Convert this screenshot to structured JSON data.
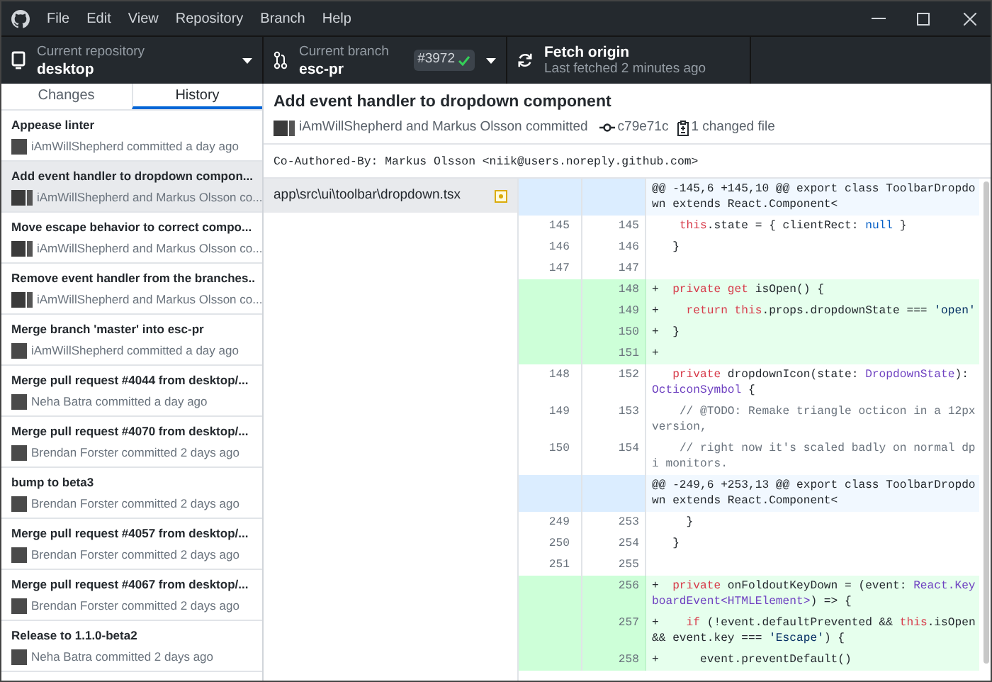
{
  "menu": [
    "File",
    "Edit",
    "View",
    "Repository",
    "Branch",
    "Help"
  ],
  "toolbar": {
    "repository": {
      "label": "Current repository",
      "value": "desktop"
    },
    "branch": {
      "label": "Current branch",
      "value": "esc-pr",
      "pr_badge": "#3972"
    },
    "fetch": {
      "title": "Fetch origin",
      "subtitle": "Last fetched 2 minutes ago"
    }
  },
  "tabs": [
    {
      "label": "Changes",
      "selected": false
    },
    {
      "label": "History",
      "selected": true
    }
  ],
  "commits": [
    {
      "title": "Appease linter",
      "author": "iAmWillShepherd committed a day ago",
      "coauthored": false,
      "selected": false
    },
    {
      "title": "Add event handler to dropdown compon...",
      "author": "iAmWillShepherd and Markus Olsson co...",
      "coauthored": true,
      "selected": true
    },
    {
      "title": "Move escape behavior to correct compo...",
      "author": "iAmWillShepherd and Markus Olsson co...",
      "coauthored": true,
      "selected": false
    },
    {
      "title": "Remove event handler from the branches..",
      "author": "iAmWillShepherd and Markus Olsson co...",
      "coauthored": true,
      "selected": false
    },
    {
      "title": "Merge branch 'master' into esc-pr",
      "author": "iAmWillShepherd committed a day ago",
      "coauthored": false,
      "selected": false
    },
    {
      "title": "Merge pull request #4044 from desktop/...",
      "author": "Neha Batra committed a day ago",
      "coauthored": false,
      "selected": false
    },
    {
      "title": "Merge pull request #4070 from desktop/...",
      "author": "Brendan Forster committed 2 days ago",
      "coauthored": false,
      "selected": false
    },
    {
      "title": "bump to beta3",
      "author": "Brendan Forster committed 2 days ago",
      "coauthored": false,
      "selected": false
    },
    {
      "title": "Merge pull request #4057 from desktop/...",
      "author": "Brendan Forster committed 2 days ago",
      "coauthored": false,
      "selected": false
    },
    {
      "title": "Merge pull request #4067 from desktop/...",
      "author": "Brendan Forster committed 2 days ago",
      "coauthored": false,
      "selected": false
    },
    {
      "title": "Release to 1.1.0-beta2",
      "author": "Neha Batra committed 2 days ago",
      "coauthored": false,
      "selected": false
    }
  ],
  "commit_detail": {
    "title": "Add event handler to dropdown component",
    "authors": "iAmWillShepherd and Markus Olsson committed",
    "sha": "c79e71c",
    "files_changed": "1 changed file",
    "message": "Co-Authored-By: Markus Olsson <niik@users.noreply.github.com>"
  },
  "files": [
    {
      "path": "app\\src\\ui\\toolbar\\dropdown.tsx",
      "selected": true
    }
  ],
  "diff": [
    {
      "kind": "hunk",
      "code": [
        {
          "text": "@@ -145,6 +145,10 @@ export class ToolbarDropdown extends React.Component<"
        }
      ]
    },
    {
      "kind": "context",
      "old": "145",
      "new": "145",
      "code": [
        {
          "text": "    this",
          "kind": "keyword"
        },
        {
          "text": ".state = { clientRect: "
        },
        {
          "text": "null",
          "kind": "literal"
        },
        {
          "text": " }"
        }
      ]
    },
    {
      "kind": "context",
      "old": "146",
      "new": "146",
      "code": [
        {
          "text": "   }"
        }
      ]
    },
    {
      "kind": "context",
      "old": "147",
      "new": "147"
    },
    {
      "kind": "added",
      "new": "148",
      "code": [
        {
          "text": "+"
        },
        {
          "text": "  private get",
          "kind": "keyword"
        },
        {
          "text": " isOpen() {"
        }
      ]
    },
    {
      "kind": "added",
      "new": "149",
      "code": [
        {
          "text": "+"
        },
        {
          "text": "    return this",
          "kind": "keyword"
        },
        {
          "text": ".props.dropdownState === "
        },
        {
          "text": "'open'",
          "kind": "string"
        }
      ]
    },
    {
      "kind": "added",
      "new": "150",
      "code": [
        {
          "text": "+  }"
        }
      ]
    },
    {
      "kind": "added",
      "new": "151",
      "code": [
        {
          "text": "+"
        }
      ]
    },
    {
      "kind": "context",
      "old": "148",
      "new": "152",
      "code": [
        {
          "text": "   private",
          "kind": "keyword"
        },
        {
          "text": " dropdownIcon(state: "
        },
        {
          "text": "DropdownState",
          "kind": "type"
        },
        {
          "text": "): "
        },
        {
          "text": "OcticonSymbol",
          "kind": "type"
        },
        {
          "text": " {"
        }
      ]
    },
    {
      "kind": "context",
      "old": "149",
      "new": "153",
      "code": [
        {
          "text": "    // @TODO: Remake triangle octicon in a 12px version,",
          "kind": "comment"
        }
      ]
    },
    {
      "kind": "context",
      "old": "150",
      "new": "154",
      "code": [
        {
          "text": "    // right now it's scaled badly on normal dpi monitors.",
          "kind": "comment"
        }
      ]
    },
    {
      "kind": "hunk",
      "code": [
        {
          "text": "@@ -249,6 +253,13 @@ export class ToolbarDropdown extends React.Component<"
        }
      ]
    },
    {
      "kind": "context",
      "old": "249",
      "new": "253",
      "code": [
        {
          "text": "     }"
        }
      ]
    },
    {
      "kind": "context",
      "old": "250",
      "new": "254",
      "code": [
        {
          "text": "   }"
        }
      ]
    },
    {
      "kind": "context",
      "old": "251",
      "new": "255"
    },
    {
      "kind": "added",
      "new": "256",
      "code": [
        {
          "text": "+"
        },
        {
          "text": "  private",
          "kind": "keyword"
        },
        {
          "text": " onFoldoutKeyDown = (event: "
        },
        {
          "text": "React.KeyboardEvent<HTMLElement>",
          "kind": "type"
        },
        {
          "text": ") => {"
        }
      ]
    },
    {
      "kind": "added",
      "new": "257",
      "code": [
        {
          "text": "+"
        },
        {
          "text": "    if",
          "kind": "keyword"
        },
        {
          "text": " (!event.defaultPrevented && "
        },
        {
          "text": "this",
          "kind": "keyword"
        },
        {
          "text": ".isOpen && event.key === "
        },
        {
          "text": "'Escape'",
          "kind": "string"
        },
        {
          "text": ") {"
        }
      ]
    },
    {
      "kind": "added",
      "new": "258",
      "code": [
        {
          "text": "+      event.preventDefault()"
        }
      ]
    }
  ]
}
